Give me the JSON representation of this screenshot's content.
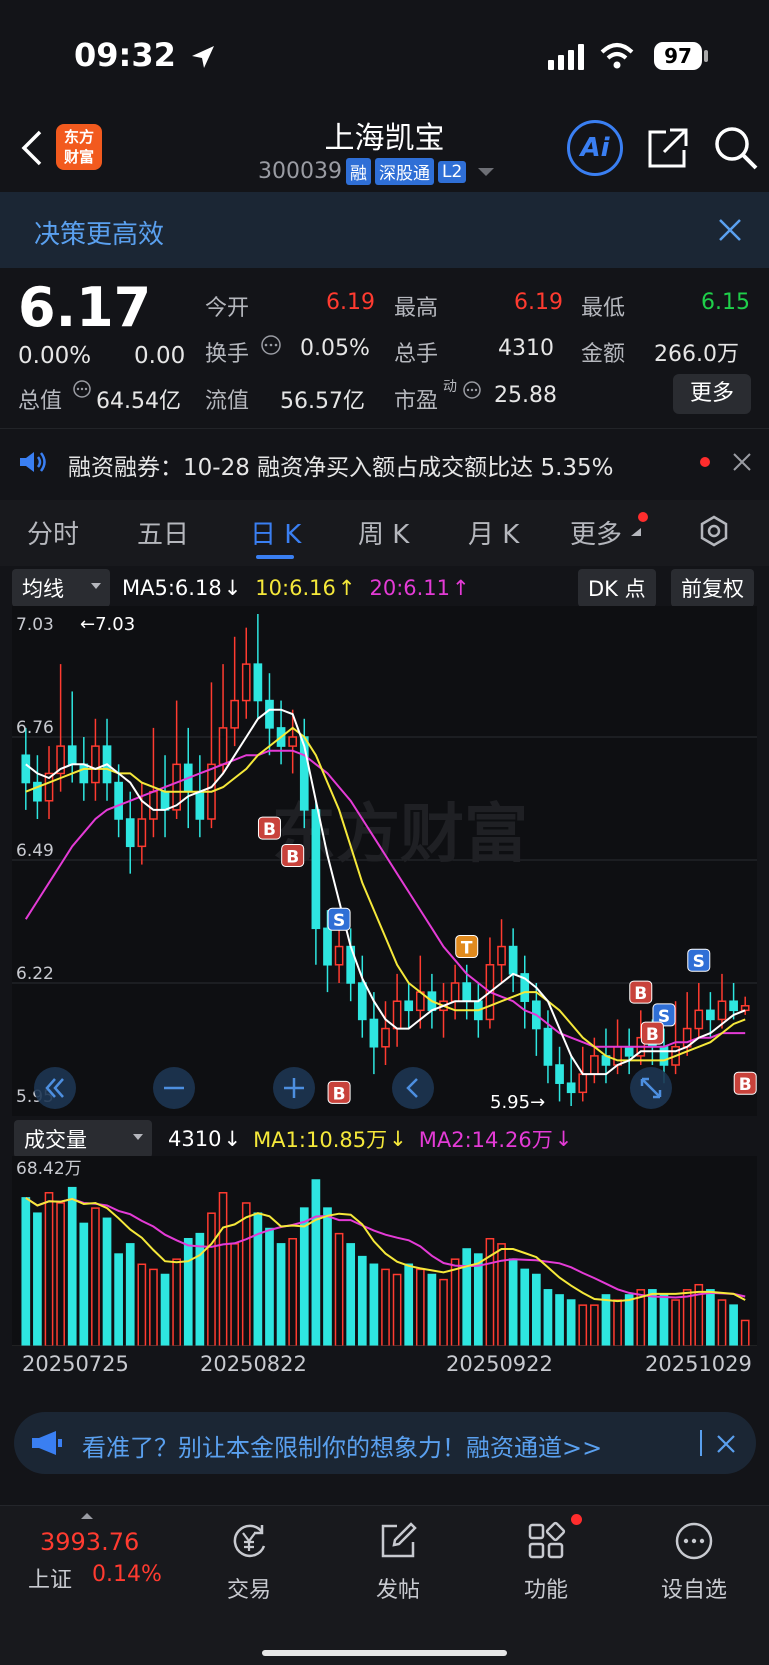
{
  "status": {
    "time": "09:32",
    "battery": "97"
  },
  "header": {
    "logo": "东方财富",
    "title": "上海凯宝",
    "code": "300039",
    "tags": [
      "融",
      "深股通",
      "L2"
    ],
    "ai_label": "Ai"
  },
  "banner": {
    "text": "决策更高效"
  },
  "quote": {
    "price": "6.17",
    "change_pct": "0.00%",
    "change": "0.00",
    "open_label": "今开",
    "open": "6.19",
    "high_label": "最高",
    "high": "6.19",
    "low_label": "最低",
    "low": "6.15",
    "turnover_label": "换手",
    "turnover": "0.05%",
    "volume_label": "总手",
    "volume": "4310",
    "amount_label": "金额",
    "amount": "266.0万",
    "mktcap_label": "总值",
    "mktcap": "64.54亿",
    "float_label": "流值",
    "float": "56.57亿",
    "pe_label": "市盈",
    "pe_sup": "动",
    "pe": "25.88",
    "more": "更多"
  },
  "notice": {
    "text": "融资融券：10-28 融资净买入额占成交额比达 5.35%"
  },
  "tabs": [
    "分时",
    "五日",
    "日 K",
    "周 K",
    "月 K",
    "更多"
  ],
  "ma_legend": {
    "type": "均线",
    "ma5": "MA5:6.18",
    "ma10": "10:6.16",
    "ma20": "20:6.11",
    "dk": "DK 点",
    "adjust": "前复权"
  },
  "vol_legend": {
    "type": "成交量",
    "vol": "4310",
    "ma1": "MA1:10.85万",
    "ma2": "MA2:14.26万"
  },
  "watermark": "东方财富",
  "colors": {
    "up": "#ff3b30",
    "down": "#2ee6e0",
    "ma5": "#ffffff",
    "ma10": "#f5e83a",
    "ma20": "#e43bd6",
    "accent": "#3a7ff2"
  },
  "chart_data": {
    "type": "candlestick",
    "price_ticks": [
      "7.03",
      "6.76",
      "6.49",
      "6.22",
      "5.95"
    ],
    "ylim": [
      5.95,
      7.03
    ],
    "high_marker": "←7.03",
    "low_marker": "5.95→",
    "dates": [
      "20250725",
      "20250822",
      "20250922",
      "20251029"
    ],
    "vol_max_label": "68.42万",
    "candles": [
      [
        6.72,
        6.66,
        6.78,
        6.6
      ],
      [
        6.66,
        6.62,
        6.72,
        6.58
      ],
      [
        6.62,
        6.68,
        6.74,
        6.58
      ],
      [
        6.68,
        6.74,
        6.92,
        6.64
      ],
      [
        6.74,
        6.7,
        6.86,
        6.66
      ],
      [
        6.7,
        6.66,
        6.76,
        6.62
      ],
      [
        6.66,
        6.74,
        6.8,
        6.62
      ],
      [
        6.74,
        6.66,
        6.8,
        6.62
      ],
      [
        6.66,
        6.58,
        6.7,
        6.54
      ],
      [
        6.58,
        6.52,
        6.64,
        6.46
      ],
      [
        6.52,
        6.58,
        6.66,
        6.48
      ],
      [
        6.58,
        6.64,
        6.78,
        6.54
      ],
      [
        6.64,
        6.6,
        6.72,
        6.54
      ],
      [
        6.6,
        6.7,
        6.84,
        6.58
      ],
      [
        6.7,
        6.64,
        6.78,
        6.56
      ],
      [
        6.64,
        6.58,
        6.72,
        6.54
      ],
      [
        6.58,
        6.7,
        6.88,
        6.56
      ],
      [
        6.7,
        6.78,
        6.92,
        6.68
      ],
      [
        6.78,
        6.84,
        6.98,
        6.74
      ],
      [
        6.84,
        6.92,
        7.0,
        6.8
      ],
      [
        6.92,
        6.84,
        7.03,
        6.8
      ],
      [
        6.84,
        6.78,
        6.9,
        6.72
      ],
      [
        6.78,
        6.74,
        6.84,
        6.7
      ],
      [
        6.74,
        6.76,
        6.82,
        6.68
      ],
      [
        6.76,
        6.6,
        6.8,
        6.56
      ],
      [
        6.6,
        6.34,
        6.62,
        6.26
      ],
      [
        6.34,
        6.26,
        6.38,
        6.2
      ],
      [
        6.26,
        6.3,
        6.36,
        6.22
      ],
      [
        6.3,
        6.22,
        6.34,
        6.18
      ],
      [
        6.22,
        6.14,
        6.28,
        6.1
      ],
      [
        6.14,
        6.08,
        6.2,
        6.02
      ],
      [
        6.08,
        6.12,
        6.18,
        6.04
      ],
      [
        6.12,
        6.18,
        6.24,
        6.08
      ],
      [
        6.18,
        6.16,
        6.22,
        6.12
      ],
      [
        6.16,
        6.2,
        6.28,
        6.12
      ],
      [
        6.2,
        6.16,
        6.24,
        6.12
      ],
      [
        6.16,
        6.18,
        6.22,
        6.1
      ],
      [
        6.18,
        6.22,
        6.26,
        6.14
      ],
      [
        6.22,
        6.18,
        6.26,
        6.14
      ],
      [
        6.18,
        6.14,
        6.22,
        6.1
      ],
      [
        6.14,
        6.26,
        6.32,
        6.12
      ],
      [
        6.26,
        6.3,
        6.36,
        6.22
      ],
      [
        6.3,
        6.24,
        6.34,
        6.2
      ],
      [
        6.24,
        6.18,
        6.28,
        6.12
      ],
      [
        6.18,
        6.12,
        6.22,
        6.06
      ],
      [
        6.12,
        6.04,
        6.16,
        6.0
      ],
      [
        6.04,
        6.0,
        6.08,
        5.96
      ],
      [
        6.0,
        5.98,
        6.06,
        5.95
      ],
      [
        5.98,
        6.02,
        6.08,
        5.96
      ],
      [
        6.02,
        6.06,
        6.1,
        6.0
      ],
      [
        6.06,
        6.04,
        6.12,
        6.0
      ],
      [
        6.04,
        6.08,
        6.14,
        6.02
      ],
      [
        6.08,
        6.06,
        6.12,
        6.02
      ],
      [
        6.06,
        6.1,
        6.16,
        6.04
      ],
      [
        6.1,
        6.08,
        6.14,
        6.04
      ],
      [
        6.08,
        6.04,
        6.12,
        6.0
      ],
      [
        6.04,
        6.08,
        6.18,
        6.02
      ],
      [
        6.08,
        6.12,
        6.2,
        6.06
      ],
      [
        6.12,
        6.16,
        6.22,
        6.1
      ],
      [
        6.16,
        6.14,
        6.2,
        6.1
      ],
      [
        6.14,
        6.18,
        6.24,
        6.12
      ],
      [
        6.18,
        6.16,
        6.22,
        6.14
      ],
      [
        6.16,
        6.17,
        6.19,
        6.15
      ]
    ],
    "volumes": [
      58,
      52,
      60,
      56,
      62,
      48,
      54,
      50,
      36,
      40,
      32,
      30,
      28,
      34,
      42,
      44,
      52,
      60,
      40,
      56,
      52,
      46,
      40,
      42,
      54,
      65,
      54,
      44,
      40,
      35,
      32,
      30,
      28,
      32,
      30,
      28,
      26,
      34,
      38,
      36,
      42,
      40,
      34,
      30,
      28,
      22,
      20,
      18,
      16,
      16,
      20,
      18,
      20,
      22,
      22,
      20,
      18,
      22,
      24,
      22,
      18,
      16,
      10
    ],
    "ma5": [
      6.7,
      6.68,
      6.67,
      6.69,
      6.7,
      6.7,
      6.69,
      6.7,
      6.68,
      6.66,
      6.62,
      6.6,
      6.6,
      6.61,
      6.63,
      6.64,
      6.65,
      6.68,
      6.72,
      6.76,
      6.8,
      6.82,
      6.82,
      6.81,
      6.74,
      6.62,
      6.5,
      6.4,
      6.3,
      6.23,
      6.18,
      6.14,
      6.12,
      6.12,
      6.14,
      6.16,
      6.17,
      6.18,
      6.18,
      6.18,
      6.2,
      6.22,
      6.24,
      6.23,
      6.21,
      6.18,
      6.12,
      6.06,
      6.02,
      6.02,
      6.02,
      6.04,
      6.05,
      6.07,
      6.07,
      6.07,
      6.07,
      6.08,
      6.1,
      6.11,
      6.13,
      6.15,
      6.16
    ],
    "ma10": [
      6.64,
      6.65,
      6.66,
      6.67,
      6.68,
      6.69,
      6.69,
      6.69,
      6.68,
      6.68,
      6.66,
      6.65,
      6.64,
      6.64,
      6.64,
      6.64,
      6.64,
      6.65,
      6.67,
      6.69,
      6.72,
      6.74,
      6.76,
      6.78,
      6.76,
      6.72,
      6.66,
      6.6,
      6.52,
      6.44,
      6.38,
      6.32,
      6.26,
      6.22,
      6.2,
      6.18,
      6.17,
      6.16,
      6.16,
      6.16,
      6.17,
      6.18,
      6.19,
      6.2,
      6.2,
      6.18,
      6.16,
      6.13,
      6.1,
      6.08,
      6.06,
      6.05,
      6.05,
      6.05,
      6.05,
      6.05,
      6.06,
      6.07,
      6.08,
      6.09,
      6.11,
      6.13,
      6.14
    ],
    "ma20": [
      6.36,
      6.4,
      6.44,
      6.48,
      6.52,
      6.55,
      6.58,
      6.6,
      6.61,
      6.62,
      6.63,
      6.64,
      6.65,
      6.66,
      6.67,
      6.68,
      6.69,
      6.7,
      6.71,
      6.72,
      6.72,
      6.73,
      6.73,
      6.73,
      6.72,
      6.7,
      6.68,
      6.65,
      6.62,
      6.58,
      6.54,
      6.5,
      6.46,
      6.42,
      6.38,
      6.34,
      6.3,
      6.27,
      6.24,
      6.22,
      6.2,
      6.19,
      6.18,
      6.16,
      6.15,
      6.13,
      6.11,
      6.1,
      6.09,
      6.08,
      6.08,
      6.08,
      6.08,
      6.08,
      6.08,
      6.08,
      6.09,
      6.09,
      6.1,
      6.1,
      6.11,
      6.11,
      6.11
    ],
    "signals": [
      {
        "label": "B",
        "i": 21,
        "price": 6.56
      },
      {
        "label": "B",
        "i": 23,
        "price": 6.5
      },
      {
        "label": "S",
        "i": 27,
        "price": 6.36
      },
      {
        "label": "B",
        "i": 27,
        "price": 5.98
      },
      {
        "label": "T",
        "i": 38,
        "price": 6.3
      },
      {
        "label": "B",
        "i": 53,
        "price": 6.2
      },
      {
        "label": "S",
        "i": 55,
        "price": 6.15
      },
      {
        "label": "B",
        "i": 54,
        "price": 6.11
      },
      {
        "label": "S",
        "i": 58,
        "price": 6.27
      },
      {
        "label": "B",
        "i": 62,
        "price": 6.0
      }
    ]
  },
  "ad": {
    "text": "看准了？别让本金限制你的想象力！融资通道>>"
  },
  "index": {
    "value": "3993.76",
    "name": "上证",
    "pct": "0.14%"
  },
  "nav": [
    "交易",
    "发帖",
    "功能",
    "设自选"
  ]
}
